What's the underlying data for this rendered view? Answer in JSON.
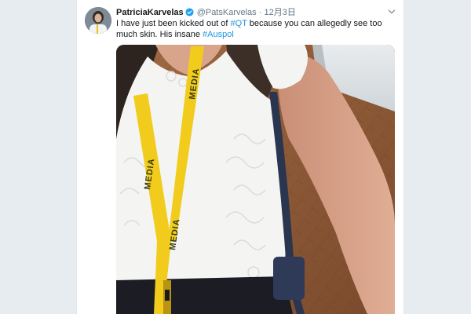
{
  "tweet": {
    "display_name": "PatriciaKarvelas",
    "handle": "@PatsKarvelas",
    "separator": "·",
    "date": "12月3日",
    "text_before_1": "I have just been kicked out of ",
    "hashtag_1": "#QT",
    "text_after_1": " because you can allegedly see too much skin. His insane ",
    "hashtag_2": "#Auspol"
  },
  "media": {
    "lanyard_text": "MEDIA"
  },
  "icons": {
    "verified": "verified-badge-icon",
    "menu": "chevron-down-icon"
  },
  "colors": {
    "background": "#e6ecf0",
    "hashtag": "#1b95e0",
    "verified": "#1da1f2",
    "lanyard": "#f2cc1c"
  }
}
